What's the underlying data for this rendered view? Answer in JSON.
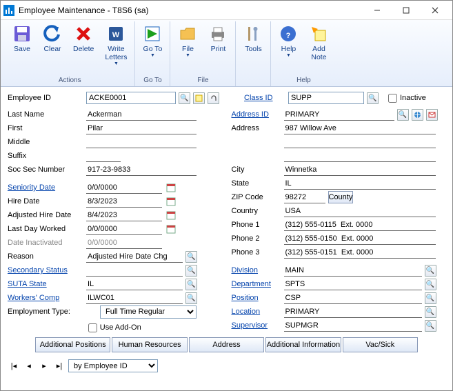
{
  "window": {
    "title": "Employee Maintenance  -  T8S6 (sa)"
  },
  "toolbar": {
    "save": "Save",
    "clear": "Clear",
    "delete": "Delete",
    "write": "Write\nLetters",
    "goto": "Go To",
    "file": "File",
    "print": "Print",
    "tools": "Tools",
    "help": "Help",
    "addnote": "Add\nNote",
    "grp_actions": "Actions",
    "grp_goto": "Go To",
    "grp_file": "File",
    "grp_help": "Help"
  },
  "labels": {
    "employee_id": "Employee ID",
    "class_id": "Class ID",
    "inactive": "Inactive",
    "last_name": "Last Name",
    "first": "First",
    "middle": "Middle",
    "suffix": "Suffix",
    "ssn": "Soc Sec Number",
    "seniority_date": "Seniority Date",
    "hire_date": "Hire Date",
    "adj_hire_date": "Adjusted Hire Date",
    "last_day": "Last Day Worked",
    "date_inact": "Date Inactivated",
    "reason": "Reason",
    "secondary_status": "Secondary Status",
    "suta": "SUTA State",
    "workers_comp": "Workers' Comp",
    "emp_type": "Employment Type:",
    "use_addon": "Use Add-On",
    "address_id": "Address ID",
    "address": "Address",
    "city": "City",
    "state": "State",
    "zip": "ZIP Code",
    "county": "County",
    "country": "Country",
    "phone1": "Phone 1",
    "phone2": "Phone 2",
    "phone3": "Phone 3",
    "division": "Division",
    "department": "Department",
    "position": "Position",
    "location": "Location",
    "supervisor": "Supervisor"
  },
  "values": {
    "employee_id": "ACKE0001",
    "class_id": "SUPP",
    "last_name": "Ackerman",
    "first": "Pilar",
    "middle": "",
    "suffix": "",
    "ssn": "917-23-9833",
    "seniority_date": "0/0/0000",
    "hire_date": "8/3/2023",
    "adj_hire_date": "8/4/2023",
    "last_day": "0/0/0000",
    "date_inact": "0/0/0000",
    "reason": "Adjusted Hire Date Chg",
    "secondary_status": "",
    "suta": "IL",
    "workers_comp": "ILWC01",
    "emp_type": "Full Time Regular",
    "address_id": "PRIMARY",
    "address_1": "987 Willow Ave",
    "address_2": "",
    "address_3": "",
    "city": "Winnetka",
    "state": "IL",
    "zip": "98272",
    "country": "USA",
    "phone1": "(312) 555-0115  Ext. 0000",
    "phone2": "(312) 555-0150  Ext. 0000",
    "phone3": "(312) 555-0151  Ext. 0000",
    "division": "MAIN",
    "department": "SPTS",
    "position": "CSP",
    "location": "PRIMARY",
    "supervisor": "SUPMGR"
  },
  "buttons": {
    "add_positions": "Additional Positions",
    "human_resources": "Human Resources",
    "address": "Address",
    "add_info": "Additional Information",
    "vac_sick": "Vac/Sick"
  },
  "nav": {
    "sort": "by Employee ID"
  }
}
